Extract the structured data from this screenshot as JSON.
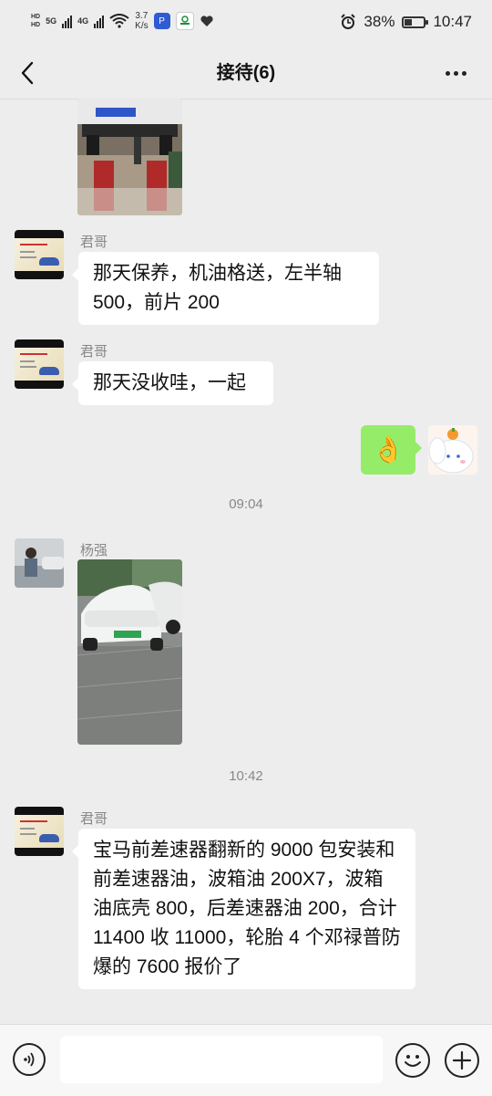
{
  "status_bar": {
    "hd_label": "HD",
    "network_1": "5G",
    "network_2": "4G",
    "net_speed_value": "3.7",
    "net_speed_unit": "K/s",
    "battery_percent": "38%",
    "battery_level": 0.38,
    "time": "10:47"
  },
  "nav": {
    "title": "接待(6)"
  },
  "messages": [
    {
      "sender": "君哥",
      "text": "那天保养，机油格送，左半轴500，前片 200"
    },
    {
      "sender": "君哥",
      "text": "那天没收哇，一起"
    },
    {
      "emoji": "👌"
    },
    {
      "sender": "杨强"
    },
    {
      "sender": "君哥",
      "text": "宝马前差速器翻新的 9000 包安装和前差速器油，波箱油 200X7，波箱油底壳 800，后差速器油 200，合计 11400 收 11000，轮胎 4 个邓禄普防爆的 7600 报价了"
    }
  ],
  "timestamps": [
    "09:04",
    "10:42"
  ],
  "colors": {
    "background": "#ededed",
    "my_bubble": "#95ec69",
    "their_bubble": "#ffffff"
  }
}
